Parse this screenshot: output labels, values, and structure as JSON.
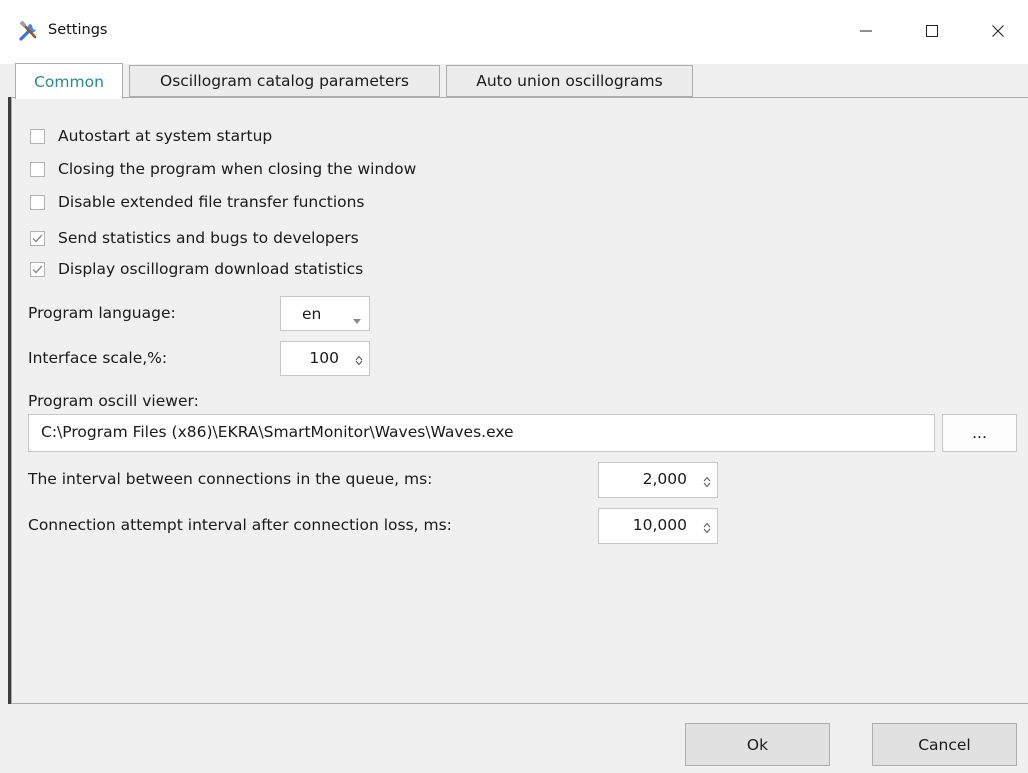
{
  "window": {
    "title": "Settings",
    "app_icon": "tools-icon",
    "controls": [
      "minimize-icon",
      "maximize-icon",
      "close-icon"
    ]
  },
  "tabs": [
    {
      "label": "Common",
      "active": true
    },
    {
      "label": "Oscillogram catalog parameters",
      "active": false
    },
    {
      "label": "Auto union oscillograms",
      "active": false
    }
  ],
  "common": {
    "checkboxes": [
      {
        "label": "Autostart at system startup",
        "checked": false
      },
      {
        "label": "Closing the program when closing the window",
        "checked": false
      },
      {
        "label": "Disable extended file transfer functions",
        "checked": false
      },
      {
        "label": "Send statistics and bugs to developers",
        "checked": true
      },
      {
        "label": "Display oscillogram download statistics",
        "checked": true
      }
    ],
    "language": {
      "label": "Program language:",
      "value": "en"
    },
    "scale": {
      "label": "Interface scale,%:",
      "value": "100"
    },
    "viewer": {
      "label": "Program oscill viewer:",
      "path": "C:\\Program Files (x86)\\EKRA\\SmartMonitor\\Waves\\Waves.exe",
      "browse_label": "..."
    },
    "queue_interval": {
      "label": "The interval between connections in the queue, ms:",
      "value": "2,000"
    },
    "retry_interval": {
      "label": "Connection attempt interval after connection loss, ms:",
      "value": "10,000"
    }
  },
  "footer": {
    "ok_label": "Ok",
    "cancel_label": "Cancel"
  },
  "colors": {
    "active_tab_text": "#2a8a8a",
    "check_mark": "#8c8c8c"
  }
}
